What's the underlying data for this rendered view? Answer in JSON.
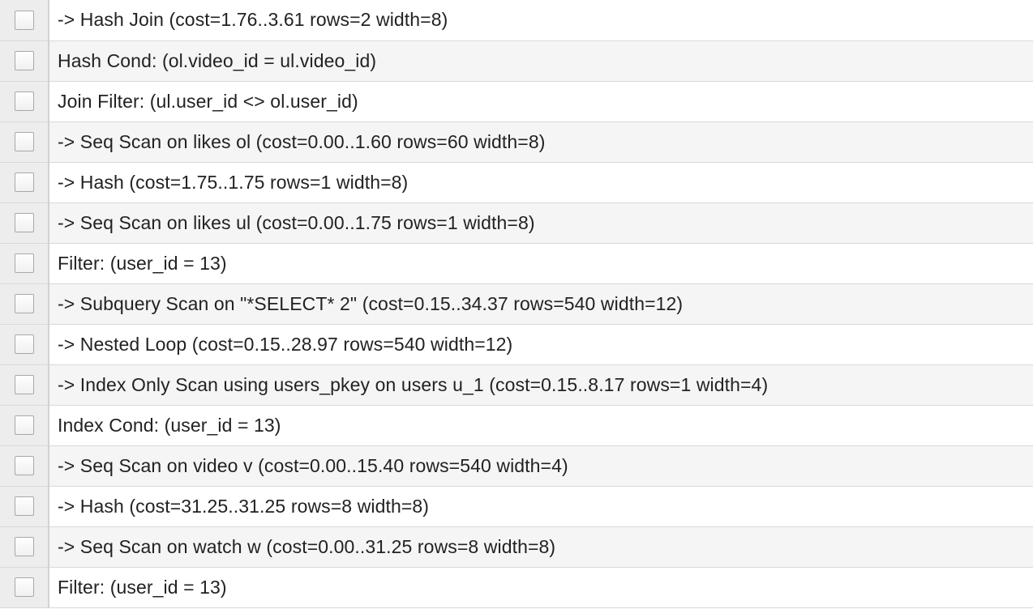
{
  "plan_rows": [
    {
      "text": "-> Hash Join (cost=1.76..3.61 rows=2 width=8)",
      "checked": false
    },
    {
      "text": "Hash Cond: (ol.video_id = ul.video_id)",
      "checked": false
    },
    {
      "text": "Join Filter: (ul.user_id <> ol.user_id)",
      "checked": false
    },
    {
      "text": "-> Seq Scan on likes ol (cost=0.00..1.60 rows=60 width=8)",
      "checked": false
    },
    {
      "text": "-> Hash (cost=1.75..1.75 rows=1 width=8)",
      "checked": false
    },
    {
      "text": "-> Seq Scan on likes ul (cost=0.00..1.75 rows=1 width=8)",
      "checked": false
    },
    {
      "text": "Filter: (user_id = 13)",
      "checked": false
    },
    {
      "text": "-> Subquery Scan on \"*SELECT* 2\" (cost=0.15..34.37 rows=540 width=12)",
      "checked": false
    },
    {
      "text": "-> Nested Loop (cost=0.15..28.97 rows=540 width=12)",
      "checked": false
    },
    {
      "text": "-> Index Only Scan using users_pkey on users u_1 (cost=0.15..8.17 rows=1 width=4)",
      "checked": false
    },
    {
      "text": "Index Cond: (user_id = 13)",
      "checked": false
    },
    {
      "text": "-> Seq Scan on video v (cost=0.00..15.40 rows=540 width=4)",
      "checked": false
    },
    {
      "text": "-> Hash (cost=31.25..31.25 rows=8 width=8)",
      "checked": false
    },
    {
      "text": "-> Seq Scan on watch w (cost=0.00..31.25 rows=8 width=8)",
      "checked": false
    },
    {
      "text": "Filter: (user_id = 13)",
      "checked": false
    }
  ]
}
